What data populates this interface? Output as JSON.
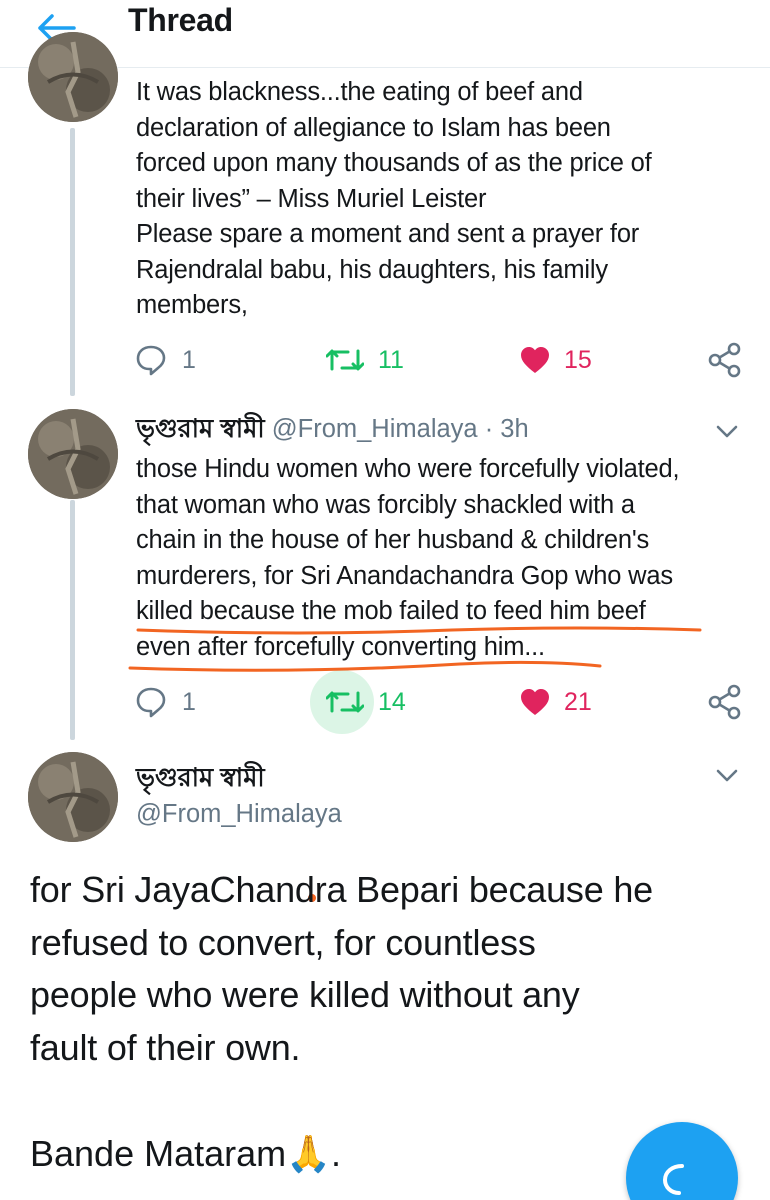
{
  "header": {
    "title": "Thread"
  },
  "tweets": [
    {
      "text": "It was blackness...the eating of beef and\ndeclaration of allegiance to Islam has been\nforced upon many thousands of as the price of\ntheir lives” –  Miss Muriel Leister\nPlease spare a moment and sent a prayer for\nRajendralal babu, his daughters, his family\nmembers,",
      "replies": "1",
      "retweets": "11",
      "likes": "15"
    },
    {
      "name": "ভৃগুরাম স্বামী",
      "handle": "@From_Himalaya",
      "separator": "·",
      "time": "3h",
      "text": "those Hindu women who were forcefully violated,\nthat woman who was forcibly shackled with a\nchain in the house of her husband & children's\nmurderers, for Sri Anandachandra Gop who was\nkilled because the mob failed to feed him beef\neven after forcefully converting him...",
      "replies": "1",
      "retweets": "14",
      "likes": "21"
    }
  ],
  "main_tweet": {
    "name": "ভৃগুরাম স্বামী",
    "handle": "@From_Himalaya",
    "text": "for Sri JayaChandra Bepari because he\nrefused to convert, for countless\npeople who were killed without any\nfault of their own.",
    "sign_off": "Bande Mataram",
    "sign_emoji": "🙏",
    "sign_end": "."
  },
  "icons": {
    "back": "arrow-left-icon",
    "reply": "reply-icon",
    "retweet": "retweet-icon",
    "like": "heart-icon",
    "share": "share-icon",
    "more": "chevron-down-icon",
    "compose": "compose-reply-icon"
  },
  "colors": {
    "accent": "#1da1f2",
    "retweet": "#17bf63",
    "like": "#e0245e",
    "secondary_text": "#657786",
    "annotation": "#f26522"
  }
}
